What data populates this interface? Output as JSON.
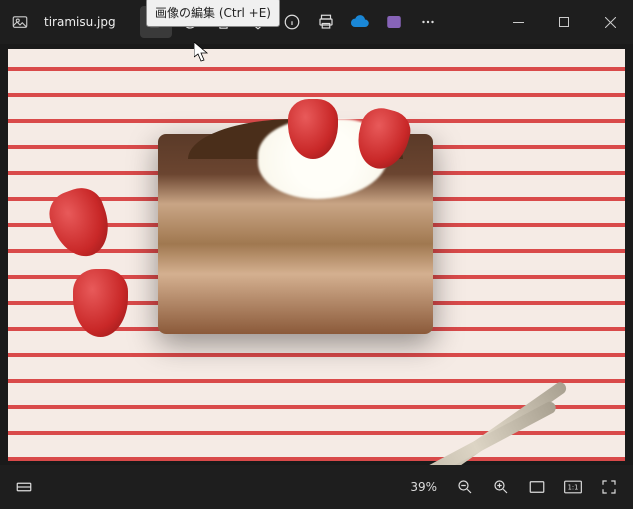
{
  "filename": "tiramisu.jpg",
  "tooltip": "画像の編集 (Ctrl +E)",
  "zoom_percent": "39%",
  "icons": {
    "app": "photos-app-icon",
    "edit": "edit-image-icon",
    "rotate": "rotate-icon",
    "delete": "trash-icon",
    "favorite": "heart-icon",
    "info": "info-icon",
    "print": "print-icon",
    "cloud": "cloud-icon",
    "clipchamp": "clipchamp-icon",
    "more": "more-icon"
  }
}
